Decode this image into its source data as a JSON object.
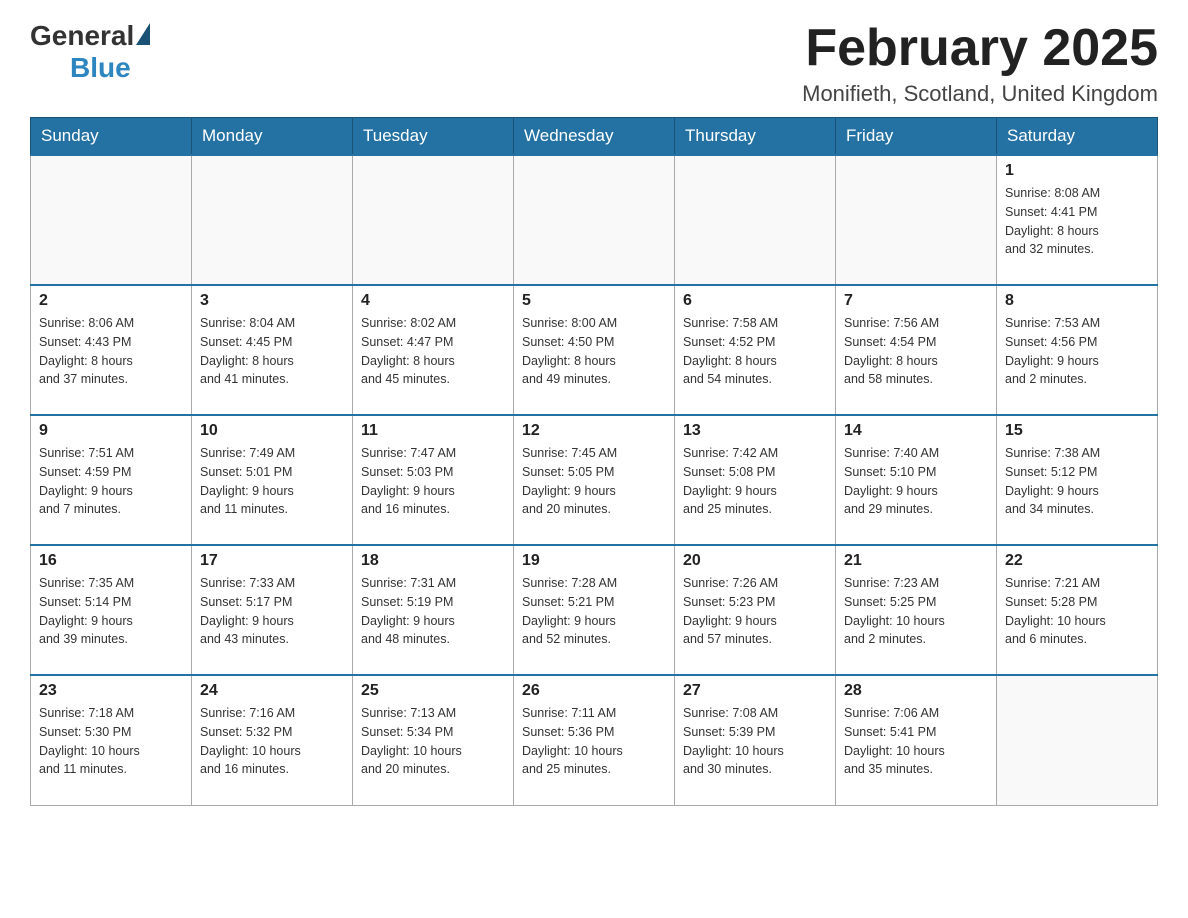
{
  "header": {
    "logo_general": "General",
    "logo_blue": "Blue",
    "month_title": "February 2025",
    "location": "Monifieth, Scotland, United Kingdom"
  },
  "days_of_week": [
    "Sunday",
    "Monday",
    "Tuesday",
    "Wednesday",
    "Thursday",
    "Friday",
    "Saturday"
  ],
  "weeks": [
    [
      {
        "day": "",
        "info": ""
      },
      {
        "day": "",
        "info": ""
      },
      {
        "day": "",
        "info": ""
      },
      {
        "day": "",
        "info": ""
      },
      {
        "day": "",
        "info": ""
      },
      {
        "day": "",
        "info": ""
      },
      {
        "day": "1",
        "info": "Sunrise: 8:08 AM\nSunset: 4:41 PM\nDaylight: 8 hours\nand 32 minutes."
      }
    ],
    [
      {
        "day": "2",
        "info": "Sunrise: 8:06 AM\nSunset: 4:43 PM\nDaylight: 8 hours\nand 37 minutes."
      },
      {
        "day": "3",
        "info": "Sunrise: 8:04 AM\nSunset: 4:45 PM\nDaylight: 8 hours\nand 41 minutes."
      },
      {
        "day": "4",
        "info": "Sunrise: 8:02 AM\nSunset: 4:47 PM\nDaylight: 8 hours\nand 45 minutes."
      },
      {
        "day": "5",
        "info": "Sunrise: 8:00 AM\nSunset: 4:50 PM\nDaylight: 8 hours\nand 49 minutes."
      },
      {
        "day": "6",
        "info": "Sunrise: 7:58 AM\nSunset: 4:52 PM\nDaylight: 8 hours\nand 54 minutes."
      },
      {
        "day": "7",
        "info": "Sunrise: 7:56 AM\nSunset: 4:54 PM\nDaylight: 8 hours\nand 58 minutes."
      },
      {
        "day": "8",
        "info": "Sunrise: 7:53 AM\nSunset: 4:56 PM\nDaylight: 9 hours\nand 2 minutes."
      }
    ],
    [
      {
        "day": "9",
        "info": "Sunrise: 7:51 AM\nSunset: 4:59 PM\nDaylight: 9 hours\nand 7 minutes."
      },
      {
        "day": "10",
        "info": "Sunrise: 7:49 AM\nSunset: 5:01 PM\nDaylight: 9 hours\nand 11 minutes."
      },
      {
        "day": "11",
        "info": "Sunrise: 7:47 AM\nSunset: 5:03 PM\nDaylight: 9 hours\nand 16 minutes."
      },
      {
        "day": "12",
        "info": "Sunrise: 7:45 AM\nSunset: 5:05 PM\nDaylight: 9 hours\nand 20 minutes."
      },
      {
        "day": "13",
        "info": "Sunrise: 7:42 AM\nSunset: 5:08 PM\nDaylight: 9 hours\nand 25 minutes."
      },
      {
        "day": "14",
        "info": "Sunrise: 7:40 AM\nSunset: 5:10 PM\nDaylight: 9 hours\nand 29 minutes."
      },
      {
        "day": "15",
        "info": "Sunrise: 7:38 AM\nSunset: 5:12 PM\nDaylight: 9 hours\nand 34 minutes."
      }
    ],
    [
      {
        "day": "16",
        "info": "Sunrise: 7:35 AM\nSunset: 5:14 PM\nDaylight: 9 hours\nand 39 minutes."
      },
      {
        "day": "17",
        "info": "Sunrise: 7:33 AM\nSunset: 5:17 PM\nDaylight: 9 hours\nand 43 minutes."
      },
      {
        "day": "18",
        "info": "Sunrise: 7:31 AM\nSunset: 5:19 PM\nDaylight: 9 hours\nand 48 minutes."
      },
      {
        "day": "19",
        "info": "Sunrise: 7:28 AM\nSunset: 5:21 PM\nDaylight: 9 hours\nand 52 minutes."
      },
      {
        "day": "20",
        "info": "Sunrise: 7:26 AM\nSunset: 5:23 PM\nDaylight: 9 hours\nand 57 minutes."
      },
      {
        "day": "21",
        "info": "Sunrise: 7:23 AM\nSunset: 5:25 PM\nDaylight: 10 hours\nand 2 minutes."
      },
      {
        "day": "22",
        "info": "Sunrise: 7:21 AM\nSunset: 5:28 PM\nDaylight: 10 hours\nand 6 minutes."
      }
    ],
    [
      {
        "day": "23",
        "info": "Sunrise: 7:18 AM\nSunset: 5:30 PM\nDaylight: 10 hours\nand 11 minutes."
      },
      {
        "day": "24",
        "info": "Sunrise: 7:16 AM\nSunset: 5:32 PM\nDaylight: 10 hours\nand 16 minutes."
      },
      {
        "day": "25",
        "info": "Sunrise: 7:13 AM\nSunset: 5:34 PM\nDaylight: 10 hours\nand 20 minutes."
      },
      {
        "day": "26",
        "info": "Sunrise: 7:11 AM\nSunset: 5:36 PM\nDaylight: 10 hours\nand 25 minutes."
      },
      {
        "day": "27",
        "info": "Sunrise: 7:08 AM\nSunset: 5:39 PM\nDaylight: 10 hours\nand 30 minutes."
      },
      {
        "day": "28",
        "info": "Sunrise: 7:06 AM\nSunset: 5:41 PM\nDaylight: 10 hours\nand 35 minutes."
      },
      {
        "day": "",
        "info": ""
      }
    ]
  ]
}
